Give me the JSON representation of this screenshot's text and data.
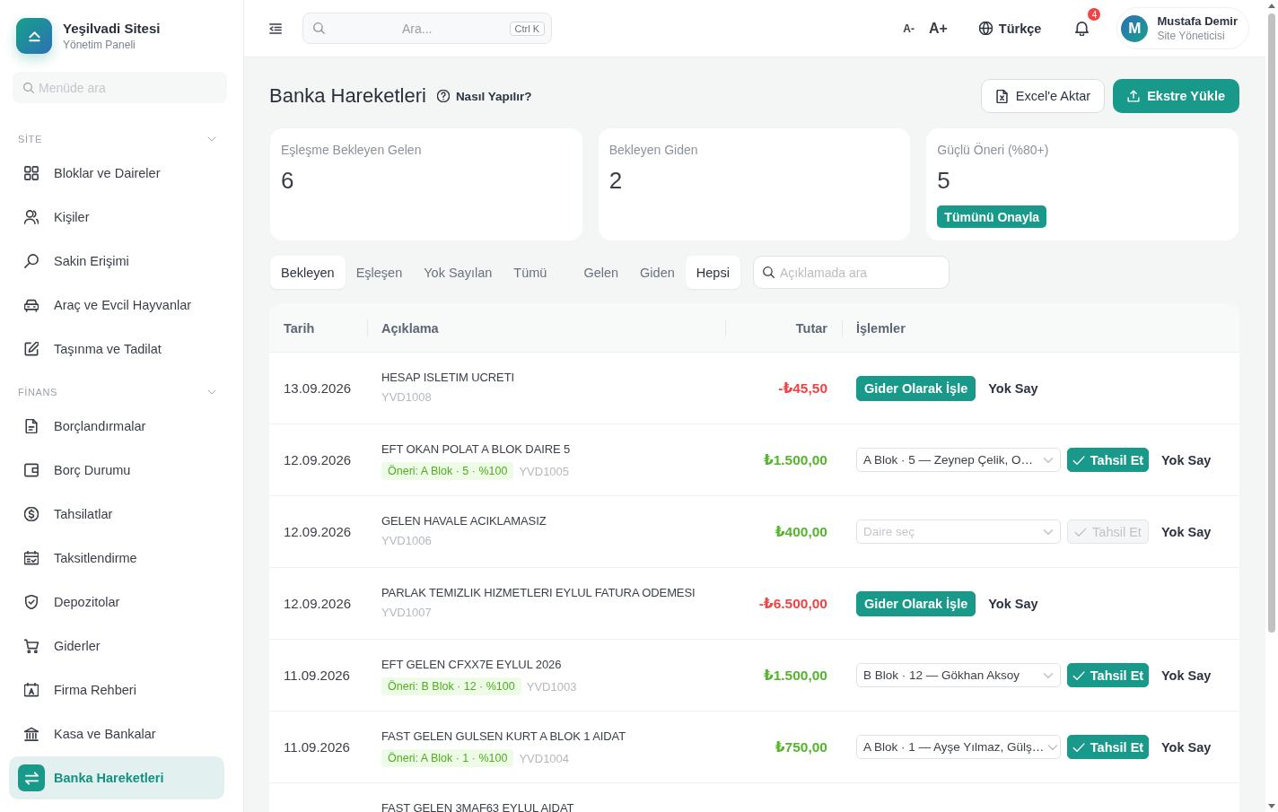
{
  "sidebar": {
    "brand": {
      "title": "Yeşilvadi Sitesi",
      "subtitle": "Yönetim Paneli"
    },
    "search": {
      "placeholder": "Menüde ara"
    },
    "sections": [
      {
        "label": "SİTE",
        "expanded": true,
        "items": [
          {
            "label": "Bloklar ve Daireler",
            "selected": false
          },
          {
            "label": "Kişiler",
            "selected": false
          },
          {
            "label": "Sakin Erişimi",
            "selected": false
          },
          {
            "label": "Araç ve Evcil Hayvanlar",
            "selected": false
          },
          {
            "label": "Taşınma ve Tadilat",
            "selected": false
          }
        ]
      },
      {
        "label": "FİNANS",
        "expanded": true,
        "items": [
          {
            "label": "Borçlandırmalar",
            "selected": false
          },
          {
            "label": "Borç Durumu",
            "selected": false
          },
          {
            "label": "Tahsilatlar",
            "selected": false
          },
          {
            "label": "Taksitlendirme",
            "selected": false
          },
          {
            "label": "Depozitolar",
            "selected": false
          },
          {
            "label": "Giderler",
            "selected": false
          },
          {
            "label": "Firma Rehberi",
            "selected": false
          },
          {
            "label": "Kasa ve Bankalar",
            "selected": false
          },
          {
            "label": "Banka Hareketleri",
            "selected": true
          }
        ]
      }
    ]
  },
  "header": {
    "search": {
      "placeholder": "Ara...",
      "shortcut": "Ctrl K"
    },
    "font_smaller": "A-",
    "font_larger": "A+",
    "language": "Türkçe",
    "notifications": {
      "count": "4"
    },
    "user": {
      "initial": "M",
      "name": "Mustafa Demir",
      "role": "Site Yöneticisi"
    }
  },
  "page": {
    "title": "Banka Hareketleri",
    "help": "Nasıl Yapılır?",
    "buttons": [
      {
        "label": "Excel'e Aktar",
        "kind": "outline"
      },
      {
        "label": "Ekstre Yükle",
        "kind": "primary"
      }
    ]
  },
  "stats": [
    {
      "label": "Eşleşme Bekleyen Gelen",
      "value": "6"
    },
    {
      "label": "Bekleyen Giden",
      "value": "2"
    },
    {
      "label": "Güçlü Öneri (%80+)",
      "value": "5",
      "action": "Tümünü Onayla"
    }
  ],
  "filters": {
    "status_tabs": [
      {
        "label": "Bekleyen",
        "selected": true
      },
      {
        "label": "Eşleşen",
        "selected": false
      },
      {
        "label": "Yok Sayılan",
        "selected": false
      },
      {
        "label": "Tümü",
        "selected": false
      }
    ],
    "direction_tabs": [
      {
        "label": "Gelen",
        "selected": false
      },
      {
        "label": "Giden",
        "selected": false
      },
      {
        "label": "Hepsi",
        "selected": true
      }
    ],
    "search": {
      "placeholder": "Açıklamada ara"
    }
  },
  "table": {
    "columns": [
      "Tarih",
      "Açıklama",
      "Tutar",
      "İşlemler"
    ],
    "rows": [
      {
        "date": "13.09.2026",
        "description": "HESAP ISLETIM UCRETI",
        "reference": "YVD1008",
        "amount": "-₺45,50",
        "kind": "expense",
        "primary_action": "Gider Olarak İşle",
        "primary_disabled": false,
        "ignore_action": "Yok Say"
      },
      {
        "date": "12.09.2026",
        "description": "EFT OKAN POLAT A BLOK DAIRE 5",
        "suggestion": "Öneri: A Blok · 5 · %100",
        "reference": "YVD1005",
        "amount": "₺1.500,00",
        "kind": "income",
        "apartment_select": {
          "value": "A Blok · 5 — Zeynep Çelik, O…"
        },
        "primary_action": "Tahsil Et",
        "primary_disabled": false,
        "ignore_action": "Yok Say"
      },
      {
        "date": "12.09.2026",
        "description": "GELEN HAVALE ACIKLAMASIZ",
        "reference": "YVD1006",
        "amount": "₺400,00",
        "kind": "income",
        "apartment_select": {
          "placeholder": "Daire seç"
        },
        "primary_action": "Tahsil Et",
        "primary_disabled": true,
        "ignore_action": "Yok Say"
      },
      {
        "date": "12.09.2026",
        "description": "PARLAK TEMIZLIK HIZMETLERI EYLUL FATURA ODEMESI",
        "reference": "YVD1007",
        "amount": "-₺6.500,00",
        "kind": "expense",
        "primary_action": "Gider Olarak İşle",
        "primary_disabled": false,
        "ignore_action": "Yok Say"
      },
      {
        "date": "11.09.2026",
        "description": "EFT GELEN CFXX7E EYLUL 2026",
        "suggestion": "Öneri: B Blok · 12 · %100",
        "reference": "YVD1003",
        "amount": "₺1.500,00",
        "kind": "income",
        "apartment_select": {
          "value": "B Blok · 12 — Gökhan Aksoy"
        },
        "primary_action": "Tahsil Et",
        "primary_disabled": false,
        "ignore_action": "Yok Say"
      },
      {
        "date": "11.09.2026",
        "description": "FAST GELEN GULSEN KURT A BLOK 1 AIDAT",
        "suggestion": "Öneri: A Blok · 1 · %100",
        "reference": "YVD1004",
        "amount": "₺750,00",
        "kind": "income",
        "apartment_select": {
          "value": "A Blok · 1 — Ayşe Yılmaz, Gülş…"
        },
        "primary_action": "Tahsil Et",
        "primary_disabled": false,
        "ignore_action": "Yok Say"
      },
      {
        "description": "FAST GELEN 3MAF63 EYLUL AIDAT"
      }
    ]
  }
}
